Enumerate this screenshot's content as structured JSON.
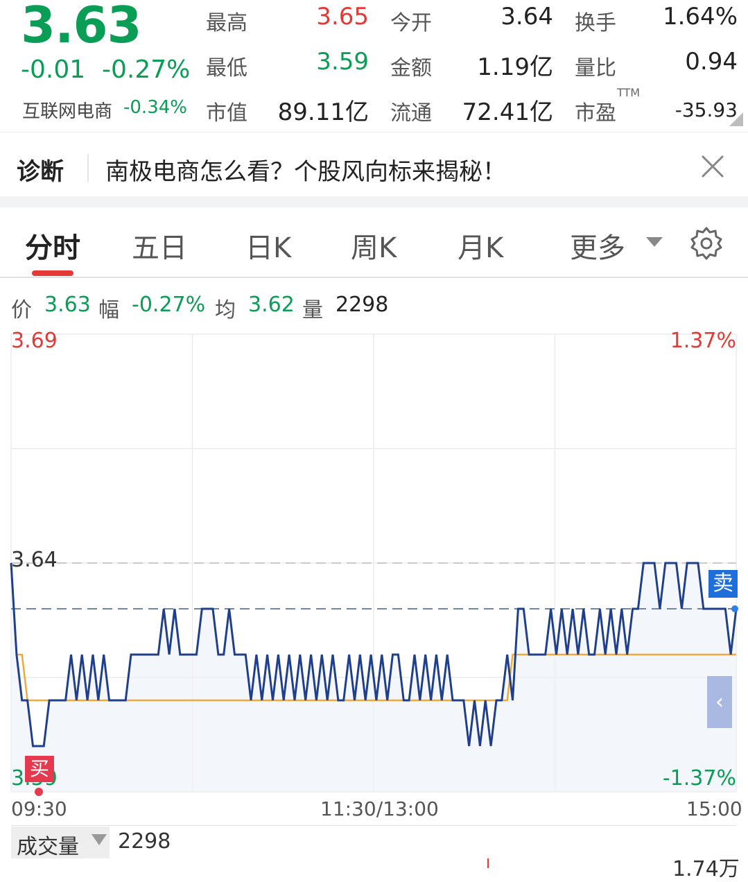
{
  "quote": {
    "price": "3.63",
    "change": "-0.01",
    "change_pct": "-0.27%",
    "sector_name": "互联网电商",
    "sector_pct": "-0.34%",
    "high_label": "最高",
    "high": "3.65",
    "open_label": "今开",
    "open": "3.64",
    "turnover_label": "换手",
    "turnover": "1.64%",
    "low_label": "最低",
    "low": "3.59",
    "amount_label": "金额",
    "amount": "1.19亿",
    "vol_ratio_label": "量比",
    "vol_ratio": "0.94",
    "mktcap_label": "市值",
    "mktcap": "89.11亿",
    "float_label": "流通",
    "float_cap": "72.41亿",
    "pe_label": "市盈",
    "pe_sup": "TTM",
    "pe": "-35.93"
  },
  "diagnosis": {
    "title": "诊断",
    "text": "南极电商怎么看？个股风向标来揭秘！"
  },
  "tabs": {
    "items": [
      "分时",
      "五日",
      "日K",
      "周K",
      "月K",
      "更多"
    ],
    "active": "分时"
  },
  "info_line": {
    "price_label": "价",
    "price": "3.63",
    "range_label": "幅",
    "range": "-0.27%",
    "avg_label": "均",
    "avg": "3.62",
    "vol_label": "量",
    "vol": "2298"
  },
  "chart": {
    "y_top": "3.69",
    "y_top_pct": "1.37%",
    "y_mid": "3.64",
    "y_bottom": "3.59",
    "y_bottom_pct": "-1.37%",
    "time_start": "09:30",
    "time_mid": "11:30/13:00",
    "time_end": "15:00",
    "sell_badge": "卖",
    "buy_badge": "买",
    "collapse_icon": "‹",
    "colors": {
      "price_line": "#1f3f8c",
      "avg_line": "#f2a93b",
      "up": "#e53935",
      "down": "#0a9d55"
    }
  },
  "chart_data": {
    "type": "line",
    "ylim": [
      3.59,
      3.69
    ],
    "reference_price": 3.64,
    "series": [
      {
        "name": "价",
        "values": [
          3.64,
          3.62,
          3.61,
          3.61,
          3.6,
          3.6,
          3.6,
          3.61,
          3.61,
          3.61,
          3.61,
          3.62,
          3.61,
          3.62,
          3.61,
          3.62,
          3.61,
          3.62,
          3.61,
          3.61,
          3.61,
          3.61,
          3.62,
          3.62,
          3.62,
          3.62,
          3.62,
          3.62,
          3.63,
          3.62,
          3.63,
          3.62,
          3.62,
          3.62,
          3.62,
          3.63,
          3.63,
          3.63,
          3.62,
          3.62,
          3.63,
          3.62,
          3.62,
          3.62,
          3.61,
          3.62,
          3.61,
          3.62,
          3.61,
          3.62,
          3.61,
          3.62,
          3.61,
          3.62,
          3.61,
          3.62,
          3.61,
          3.62,
          3.61,
          3.62,
          3.61,
          3.61,
          3.62,
          3.61,
          3.62,
          3.61,
          3.62,
          3.61,
          3.62,
          3.61,
          3.62,
          3.62,
          3.61,
          3.61,
          3.62,
          3.61,
          3.62,
          3.61,
          3.62,
          3.61,
          3.62,
          3.61,
          3.61,
          3.61,
          3.6,
          3.61,
          3.6,
          3.61,
          3.6,
          3.61,
          3.61,
          3.62,
          3.61,
          3.63,
          3.63,
          3.62,
          3.62,
          3.62,
          3.62,
          3.63,
          3.62,
          3.63,
          3.62,
          3.63,
          3.62,
          3.63,
          3.62,
          3.62,
          3.63,
          3.62,
          3.63,
          3.62,
          3.63,
          3.62,
          3.63,
          3.63,
          3.64,
          3.64,
          3.64,
          3.63,
          3.64,
          3.64,
          3.64,
          3.63,
          3.64,
          3.64,
          3.64,
          3.63,
          3.63,
          3.63,
          3.63,
          3.63,
          3.62,
          3.63
        ]
      },
      {
        "name": "均",
        "values": [
          3.64,
          3.62,
          3.62,
          3.61,
          3.61,
          3.61,
          3.61,
          3.61,
          3.61,
          3.61,
          3.61,
          3.61,
          3.61,
          3.61,
          3.61,
          3.61,
          3.61,
          3.61,
          3.61,
          3.61,
          3.61,
          3.61,
          3.61,
          3.61,
          3.61,
          3.61,
          3.61,
          3.61,
          3.61,
          3.61,
          3.61,
          3.61,
          3.61,
          3.61,
          3.61,
          3.61,
          3.61,
          3.61,
          3.61,
          3.61,
          3.61,
          3.61,
          3.61,
          3.61,
          3.61,
          3.61,
          3.61,
          3.61,
          3.61,
          3.61,
          3.61,
          3.61,
          3.61,
          3.61,
          3.61,
          3.61,
          3.61,
          3.61,
          3.61,
          3.61,
          3.61,
          3.61,
          3.61,
          3.61,
          3.61,
          3.61,
          3.61,
          3.61,
          3.61,
          3.61,
          3.61,
          3.61,
          3.61,
          3.61,
          3.61,
          3.61,
          3.61,
          3.61,
          3.61,
          3.61,
          3.61,
          3.61,
          3.61,
          3.61,
          3.61,
          3.61,
          3.61,
          3.61,
          3.61,
          3.61,
          3.61,
          3.61,
          3.62,
          3.62,
          3.62,
          3.62,
          3.62,
          3.62,
          3.62,
          3.62,
          3.62,
          3.62,
          3.62,
          3.62,
          3.62,
          3.62,
          3.62,
          3.62,
          3.62,
          3.62,
          3.62,
          3.62,
          3.62,
          3.62,
          3.62,
          3.62,
          3.62,
          3.62,
          3.62,
          3.62,
          3.62,
          3.62,
          3.62,
          3.62,
          3.62,
          3.62,
          3.62,
          3.62,
          3.62,
          3.62,
          3.62,
          3.62,
          3.62,
          3.62
        ]
      }
    ],
    "x": [
      "09:30",
      "11:30/13:00",
      "15:00"
    ]
  },
  "volume": {
    "selector_label": "成交量",
    "value": "2298",
    "max_label": "1.74万"
  }
}
